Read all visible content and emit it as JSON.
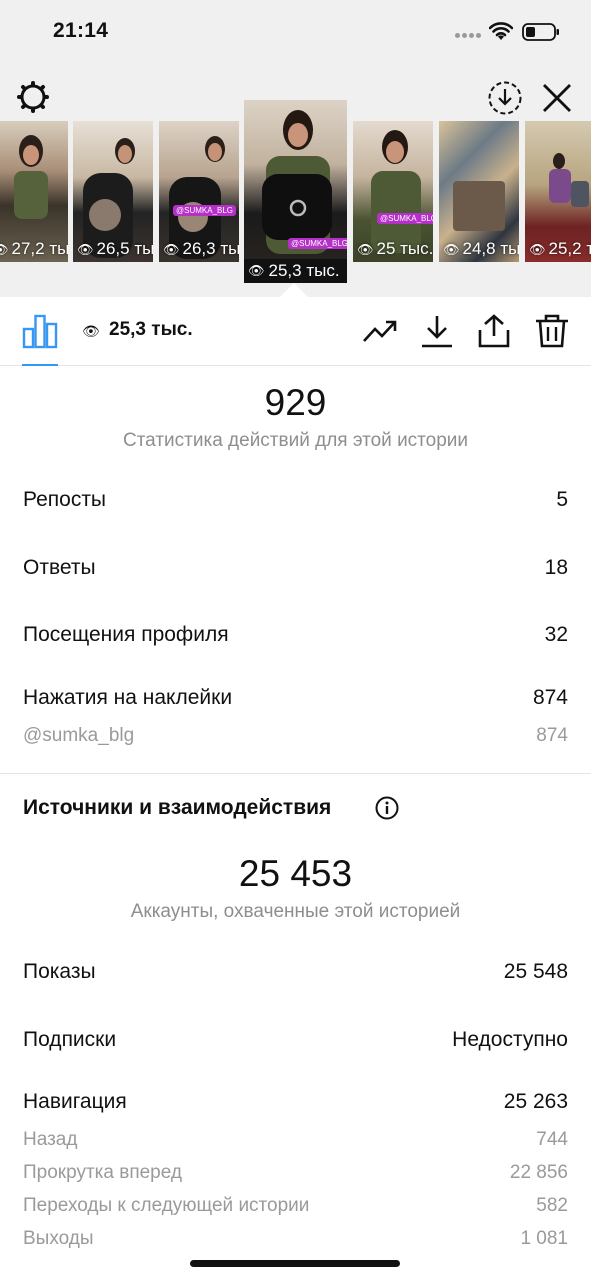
{
  "status_bar": {
    "time": "21:14"
  },
  "stories": [
    {
      "views": "27,2 тыс."
    },
    {
      "views": "26,5 тыс."
    },
    {
      "views": "26,3 тыс."
    },
    {
      "views": "25,3 тыс.",
      "selected": true,
      "sticker": "@SUMKA_BLG"
    },
    {
      "views": "25 тыс.",
      "sticker": "@SUMKA_BLG"
    },
    {
      "views": "24,8 тыс."
    },
    {
      "views": "25,2 тыс."
    }
  ],
  "toolbar": {
    "views": "25,3 тыс."
  },
  "actions": {
    "total": "929",
    "caption": "Статистика действий для этой истории",
    "rows": [
      {
        "label": "Репосты",
        "value": "5"
      },
      {
        "label": "Ответы",
        "value": "18"
      },
      {
        "label": "Посещения профиля",
        "value": "32"
      },
      {
        "label": "Нажатия на наклейки",
        "value": "874"
      }
    ],
    "sticker_row": {
      "label": "@sumka_blg",
      "value": "874"
    }
  },
  "discovery": {
    "title": "Источники и взаимодействия",
    "total": "25 453",
    "caption": "Аккаунты, охваченные этой историей",
    "impressions": {
      "label": "Показы",
      "value": "25 548"
    },
    "follows": {
      "label": "Подписки",
      "value": "Недоступно"
    },
    "navigation": {
      "label": "Навигация",
      "value": "25 263"
    },
    "nav_rows": [
      {
        "label": "Назад",
        "value": "744"
      },
      {
        "label": "Прокрутка вперед",
        "value": "22 856"
      },
      {
        "label": "Переходы к следующей истории",
        "value": "582"
      },
      {
        "label": "Выходы",
        "value": "1 081"
      }
    ]
  },
  "colors": {
    "accent": "#3897f0",
    "muted": "#8e8e8e",
    "sticker": "#b530c8"
  }
}
